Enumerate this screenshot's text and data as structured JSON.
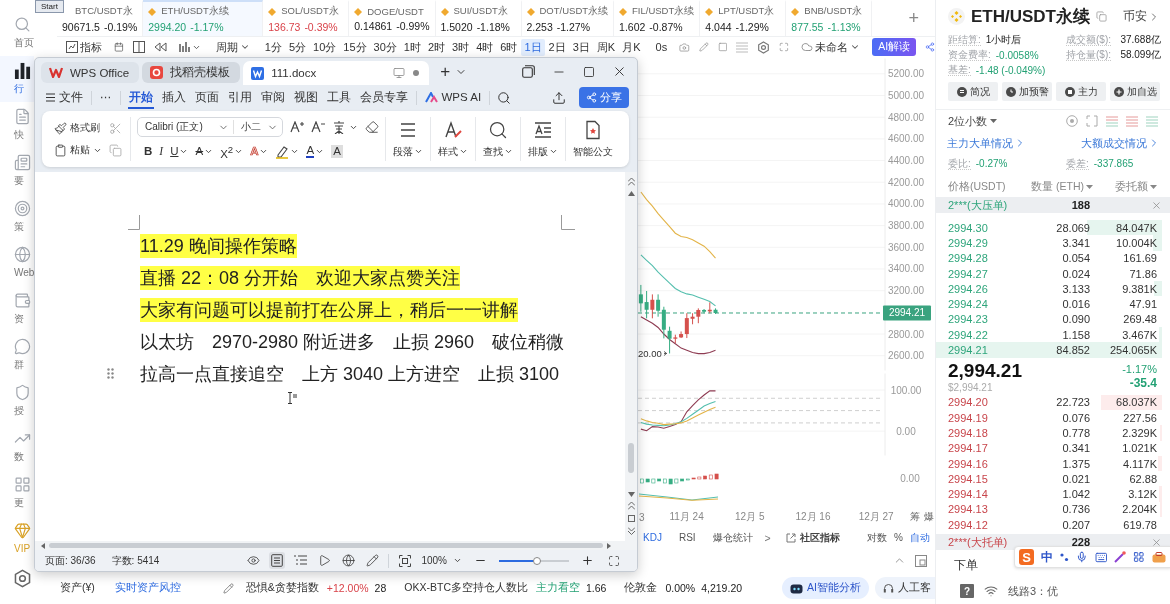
{
  "start_tooltip": "Start",
  "sidebar": {
    "items": [
      {
        "label": "首页",
        "kind": "nav",
        "selected": false
      },
      {
        "label": "行",
        "kind": "nav",
        "selected": true
      },
      {
        "label": "快",
        "kind": "nav",
        "selected": false
      },
      {
        "label": "要",
        "kind": "nav",
        "selected": false
      },
      {
        "label": "策",
        "kind": "nav",
        "selected": false
      },
      {
        "label": "Web",
        "kind": "nav",
        "selected": false
      },
      {
        "label": "资",
        "kind": "nav",
        "selected": false
      },
      {
        "label": "群",
        "kind": "nav",
        "selected": false
      },
      {
        "label": "授",
        "kind": "nav",
        "selected": false
      },
      {
        "label": "数",
        "kind": "nav",
        "selected": false
      },
      {
        "label": "更",
        "kind": "nav",
        "selected": false
      },
      {
        "label": "VIP",
        "kind": "vip",
        "selected": false
      }
    ]
  },
  "tickers": [
    {
      "name": "BTC/USDT永",
      "price": "90671.5",
      "change": "-0.19%",
      "kind": "neutral",
      "marked": false,
      "selected": false
    },
    {
      "name": "ETH/USDT永续",
      "price": "2994.20",
      "change": "-1.17%",
      "kind": "down",
      "marked": true,
      "selected": true
    },
    {
      "name": "SOL/USDT永",
      "price": "136.73",
      "change": "-0.39%",
      "kind": "up",
      "marked": true,
      "selected": false
    },
    {
      "name": "DOGE/USDT",
      "price": "0.14861",
      "change": "-0.99%",
      "kind": "neutral",
      "marked": true,
      "selected": false
    },
    {
      "name": "SUI/USDT永",
      "price": "1.5020",
      "change": "-1.18%",
      "kind": "neutral",
      "marked": true,
      "selected": false
    },
    {
      "name": "DOT/USDT永续",
      "price": "2.253",
      "change": "-1.27%",
      "kind": "neutral",
      "marked": true,
      "selected": false
    },
    {
      "name": "FIL/USDT永续",
      "price": "1.602",
      "change": "-0.87%",
      "kind": "neutral",
      "marked": true,
      "selected": false
    },
    {
      "name": "LPT/USDT永",
      "price": "4.044",
      "change": "-1.29%",
      "kind": "neutral",
      "marked": true,
      "selected": false
    },
    {
      "name": "BNB/USDT永",
      "price": "877.55",
      "change": "-1.13%",
      "kind": "down",
      "marked": true,
      "selected": false
    }
  ],
  "add_tab": "+",
  "toolbar": {
    "indicators": "指标",
    "period": "周期",
    "intervals": [
      {
        "label": "1分",
        "selected": false
      },
      {
        "label": "5分",
        "selected": false
      },
      {
        "label": "10分",
        "selected": false
      },
      {
        "label": "15分",
        "selected": false
      },
      {
        "label": "30分",
        "selected": false
      },
      {
        "label": "1时",
        "selected": false
      },
      {
        "label": "2时",
        "selected": false
      },
      {
        "label": "3时",
        "selected": false
      },
      {
        "label": "4时",
        "selected": false
      },
      {
        "label": "6时",
        "selected": false
      },
      {
        "label": "1日",
        "selected": true
      },
      {
        "label": "2日",
        "selected": false
      },
      {
        "label": "3日",
        "selected": false
      },
      {
        "label": "周K",
        "selected": false
      },
      {
        "label": "月K",
        "selected": false
      }
    ],
    "timer": "0s",
    "layout": "未命名",
    "ai_button": "AI解读"
  },
  "wps": {
    "tabs": [
      {
        "label": "WPS Office",
        "kind": "home",
        "selected": false
      },
      {
        "label": "找稻壳模板",
        "kind": "template",
        "selected": false
      },
      {
        "label": "111.docx",
        "kind": "document",
        "selected": true
      }
    ],
    "new_tab": "+",
    "menu": {
      "file": "文件",
      "more": "⋯",
      "items": [
        {
          "label": "开始",
          "selected": true
        },
        {
          "label": "插入",
          "selected": false
        },
        {
          "label": "页面",
          "selected": false
        },
        {
          "label": "引用",
          "selected": false
        },
        {
          "label": "审阅",
          "selected": false
        },
        {
          "label": "视图",
          "selected": false
        },
        {
          "label": "工具",
          "selected": false
        },
        {
          "label": "会员专享",
          "selected": false
        }
      ],
      "ai": "WPS AI",
      "share": "分享"
    },
    "ribbon": {
      "format_painter": "格式刷",
      "paste": "粘贴",
      "font": "Calibri (正文)",
      "font_size": "小二",
      "format_buttons": [
        {
          "kind": "bold",
          "label": "B",
          "dropdown": false
        },
        {
          "kind": "italic",
          "label": "I",
          "dropdown": false
        },
        {
          "kind": "underline",
          "label": "U",
          "dropdown": true
        },
        {
          "kind": "strike",
          "label": "A",
          "dropdown": true
        },
        {
          "kind": "superscript",
          "label": "X$^{2}$",
          "dropdown": true
        },
        {
          "kind": "outline",
          "label": "A",
          "dropdown": true
        },
        {
          "kind": "highlight",
          "dropdown": true
        },
        {
          "kind": "color",
          "label": "A",
          "dropdown": true
        },
        {
          "kind": "shade",
          "label": "A",
          "dropdown": false
        }
      ],
      "groups": [
        {
          "label": "段落",
          "kind": "paragraph",
          "dropdown": true
        },
        {
          "label": "样式",
          "kind": "styles",
          "dropdown": true
        },
        {
          "label": "查找",
          "kind": "find",
          "dropdown": true
        },
        {
          "label": "排版",
          "kind": "layout",
          "dropdown": true
        },
        {
          "label": "智能公文",
          "kind": "smart",
          "dropdown": false
        }
      ]
    },
    "document": {
      "paragraphs": [
        {
          "text": "11.29 晚间操作策略",
          "highlighted": true,
          "drag_handle": false
        },
        {
          "text": "直播 22：08 分开始　欢迎大家点赞关注",
          "highlighted": true,
          "drag_handle": false
        },
        {
          "text": "大家有问题可以提前打在公屏上，稍后一一讲解",
          "highlighted": true,
          "drag_handle": false
        },
        {
          "text": "以太坊　2970-2980 附近进多　止损 2960　破位稍微",
          "highlighted": false,
          "drag_handle": false
        },
        {
          "text": "拉高一点直接追空　上方 3040 上方进空　止损 3100",
          "highlighted": false,
          "drag_handle": true
        }
      ]
    },
    "status": {
      "pages": "页面: 36/36",
      "words": "字数: 5414",
      "view_modes": [
        {
          "selected": false
        },
        {
          "selected": true
        },
        {
          "selected": false
        },
        {
          "selected": false
        },
        {
          "selected": false
        },
        {
          "selected": false
        }
      ],
      "zoom": "100%",
      "zoom_slider": {
        "level": 0.54
      }
    }
  },
  "chart": {
    "chart_data": [
      {
        "type": "candlestick",
        "categories": [
          null,
          null,
          null,
          null,
          null,
          null,
          null,
          null,
          null,
          null,
          null,
          null,
          null,
          null,
          null,
          null,
          null,
          null,
          null,
          null,
          null,
          null,
          null,
          null,
          null,
          null,
          null,
          null,
          null,
          null,
          null,
          null,
          null,
          null,
          null,
          null,
          null,
          null,
          null,
          null,
          null,
          null,
          null
        ],
        "ohlc": [
          [
            3166,
            3253,
            3006,
            3083
          ],
          [
            3095,
            3197,
            2945,
            3024
          ],
          [
            3024,
            3166,
            2945,
            3116
          ],
          [
            3116,
            3166,
            2960,
            3015
          ],
          [
            3024,
            3052,
            2760,
            2840
          ],
          [
            2830,
            2868,
            2621,
            2757
          ],
          [
            2757,
            2794,
            2717,
            2769
          ],
          [
            2769,
            2824,
            2763,
            2800
          ],
          [
            2800,
            2992,
            2763,
            2947
          ],
          [
            2941,
            2992,
            2890,
            2960
          ],
          [
            2960,
            3037,
            2900,
            3022
          ],
          [
            3022,
            3031,
            2991,
            3006
          ],
          [
            3009,
            3092,
            2991,
            3024
          ],
          [
            3024,
            3037,
            2985,
            2994.21
          ],
          null,
          null,
          null,
          null,
          null,
          null,
          null,
          null,
          null,
          null,
          null,
          null,
          null,
          null,
          null,
          null,
          null,
          null,
          null,
          null,
          null,
          null,
          null,
          null,
          null,
          null,
          null,
          null,
          null
        ],
        "series": [
          {
            "type": "line",
            "color": "#e3b448",
            "values": [
              4110,
              4040,
              3980,
              3910,
              3850,
              3790,
              3730,
              3700,
              3690,
              3670,
              3640,
              3610,
              3560,
              3500,
              null,
              null,
              null,
              null,
              null,
              null,
              null,
              null,
              null,
              null,
              null,
              null,
              null,
              null,
              null,
              null,
              null,
              null,
              null,
              null,
              null,
              null,
              null,
              null,
              null,
              null,
              null,
              null,
              null
            ]
          },
          {
            "type": "line",
            "color": "#55bfae",
            "values": [
              3530,
              3480,
              3430,
              3370,
              3320,
              3270,
              3220,
              3190,
              3170,
              3160,
              3140,
              3120,
              3100,
              3060,
              null,
              null,
              null,
              null,
              null,
              null,
              null,
              null,
              null,
              null,
              null,
              null,
              null,
              null,
              null,
              null,
              null,
              null,
              null,
              null,
              null,
              null,
              null,
              null,
              null,
              null,
              null,
              null,
              null
            ]
          },
          {
            "type": "line",
            "color": "#8e3b52",
            "values": [
              2960,
              2930,
              2900,
              2860,
              2800,
              2750,
              2710,
              2670,
              2650,
              2630,
              2620,
              2620,
              2630,
              2650,
              null,
              null,
              null,
              null,
              null,
              null,
              null,
              null,
              null,
              null,
              null,
              null,
              null,
              null,
              null,
              null,
              null,
              null,
              null,
              null,
              null,
              null,
              null,
              null,
              null,
              null,
              null,
              null,
              null
            ]
          }
        ],
        "ylim": [
          2450,
          5355
        ],
        "yticks": [
          {
            "value": 2600,
            "label": "2600.00"
          },
          {
            "value": 2800,
            "label": "2800.00"
          },
          {
            "value": 3200,
            "label": "3200.00"
          },
          {
            "value": 3400,
            "label": "3400.00"
          },
          {
            "value": 3600,
            "label": "3600.00"
          },
          {
            "value": 3800,
            "label": "3800.00"
          },
          {
            "value": 4000,
            "label": "4000.00"
          },
          {
            "value": 4200,
            "label": "4200.00"
          },
          {
            "value": 4400,
            "label": "4400.00"
          },
          {
            "value": 4600,
            "label": "4600.00"
          },
          {
            "value": 4800,
            "label": "4800.00"
          },
          {
            "value": 5000,
            "label": "5000.00"
          },
          {
            "value": 5200,
            "label": "5200.00"
          }
        ],
        "tick_labels": "y",
        "ref_lines": [
          {
            "axis": "y",
            "value": 2994.21,
            "label": "2994.21",
            "color": "#3aa37f",
            "line_style": "dashed"
          }
        ],
        "annotations": [
          "20.00"
        ],
        "grid": true
      },
      {
        "type": "line",
        "categories": [
          null,
          null,
          null,
          null,
          null,
          null,
          null,
          null,
          null,
          null,
          null,
          null,
          null,
          null,
          null,
          null,
          null,
          null,
          null,
          null,
          null,
          null,
          null,
          null,
          null,
          null,
          null,
          null,
          null,
          null,
          null,
          null,
          null,
          null,
          null,
          null,
          null,
          null,
          null,
          null,
          null,
          null,
          null
        ],
        "series": [
          {
            "color": "#8e3b52",
            "values": [
              5,
              1,
              11,
              10,
              7,
              11,
              16,
              23,
              47,
              62,
              76,
              88,
              98,
              98,
              null,
              null,
              null,
              null,
              null,
              null,
              null,
              null,
              null,
              null,
              null,
              null,
              null,
              null,
              null,
              null,
              null,
              null,
              null,
              null,
              null,
              null,
              null,
              null,
              null,
              null,
              null,
              null,
              null
            ]
          },
          {
            "color": "#55bfae",
            "values": [
              21,
              17,
              15,
              14,
              13,
              15,
              18,
              23,
              31,
              41,
              51,
              61,
              67,
              72,
              null,
              null,
              null,
              null,
              null,
              null,
              null,
              null,
              null,
              null,
              null,
              null,
              null,
              null,
              null,
              null,
              null,
              null,
              null,
              null,
              null,
              null,
              null,
              null,
              null,
              null,
              null,
              null,
              null
            ]
          },
          {
            "color": "#e3b448",
            "values": [
              30,
              25,
              21,
              19,
              16,
              17,
              18,
              20,
              25,
              32,
              39,
              46,
              53,
              58,
              null,
              null,
              null,
              null,
              null,
              null,
              null,
              null,
              null,
              null,
              null,
              null,
              null,
              null,
              null,
              null,
              null,
              null,
              null,
              null,
              null,
              null,
              null,
              null,
              null,
              null,
              null,
              null,
              null
            ]
          }
        ],
        "ylim": [
          -63,
          144
        ],
        "yticks": [
          {
            "value": 0,
            "label": "0.00"
          },
          {
            "value": 100,
            "label": "100.00"
          }
        ],
        "tick_labels": "y",
        "ref_lines": [
          {
            "axis": "y",
            "value": 80,
            "color": "#cfcfcf",
            "line_style": "dashed"
          },
          {
            "axis": "y",
            "value": 50,
            "color": "#cfcfcf",
            "line_style": "dashed"
          },
          {
            "axis": "y",
            "value": 20,
            "color": "#cfcfcf",
            "line_style": "dashed"
          }
        ],
        "grid": true
      }
    ],
    "macd_axis_label": "0.00",
    "x_axis": {
      "fragment": "3",
      "labels": [
        "11月 24",
        "12月 5",
        "12月 16",
        "12月 27"
      ],
      "buttons": [
        "筹",
        "爆"
      ]
    },
    "indicator_tabs": [
      {
        "label": "KDJ",
        "selected": true
      },
      {
        "label": "RSI",
        "selected": false
      },
      {
        "label": "爆仓统计",
        "selected": false
      }
    ],
    "more": ">",
    "community": "社区指标",
    "scale_options": [
      {
        "label": "对数",
        "selected": false
      },
      {
        "label": "%",
        "selected": false
      },
      {
        "label": "自动",
        "selected": true
      }
    ]
  },
  "bottom_bar": {
    "asset_label": "资产(¥)",
    "risk_link": "实时资产风控",
    "indicators": [
      {
        "name": "恐惧&贪婪指数",
        "values": [
          {
            "text": "+12.00%",
            "kind": "up"
          },
          {
            "text": "28",
            "kind": "neutral"
          }
        ]
      },
      {
        "name": "OKX-BTC多空持仓人数比",
        "values": [
          {
            "text": "主力看空",
            "kind": "down"
          },
          {
            "text": "1.66",
            "kind": "neutral"
          }
        ]
      },
      {
        "name": "伦敦金",
        "values": [
          {
            "text": "0.00%",
            "kind": "neutral"
          },
          {
            "text": "4,219.20",
            "kind": "neutral"
          }
        ]
      }
    ],
    "ai_button": "AI智能分析",
    "service_button": "人工客"
  },
  "right_panel": {
    "symbol": "ETH/USDT永续",
    "exchange": "币安",
    "stats": [
      {
        "label": "距结算:",
        "value": "1小时后",
        "kind": "neutral"
      },
      {
        "label": "成交额($):",
        "value": "37.688亿",
        "kind": "neutral"
      },
      {
        "label": "资金费率:",
        "value": "-0.0058%",
        "kind": "down"
      },
      {
        "label": "持仓量($):",
        "value": "58.099亿",
        "kind": "neutral"
      },
      {
        "label": "基差:",
        "value": "-1.48 (-0.049%)",
        "kind": "down"
      }
    ],
    "actions": [
      "简况",
      "加预警",
      "主力",
      "加自选"
    ],
    "decimals": "2位小数",
    "links": [
      "主力大单情况",
      "大额成交情况"
    ],
    "ratios": [
      {
        "label": "委比:",
        "value": "-0.27%",
        "kind": "down"
      },
      {
        "label": "委差:",
        "value": "-337.865",
        "kind": "down"
      }
    ],
    "columns": [
      "价格(USDT)",
      "数量 (ETH)",
      "委托额"
    ],
    "pinned_ask": {
      "label": "2***(大压单)",
      "amount": "188"
    },
    "asks": [
      {
        "price": "2994.30",
        "qty": "28.069",
        "total": "84.047K"
      },
      {
        "price": "2994.29",
        "qty": "3.341",
        "total": "10.004K"
      },
      {
        "price": "2994.28",
        "qty": "0.054",
        "total": "161.69"
      },
      {
        "price": "2994.27",
        "qty": "0.024",
        "total": "71.86"
      },
      {
        "price": "2994.26",
        "qty": "3.133",
        "total": "9.381K"
      },
      {
        "price": "2994.24",
        "qty": "0.016",
        "total": "47.91"
      },
      {
        "price": "2994.23",
        "qty": "0.090",
        "total": "269.48"
      },
      {
        "price": "2994.22",
        "qty": "1.158",
        "total": "3.467K"
      },
      {
        "price": "2994.21",
        "qty": "84.852",
        "total": "254.065K"
      }
    ],
    "last": {
      "price": "2,994.21",
      "usd": "$2,994.21",
      "change_pct": "-1.17%",
      "change": "-35.4",
      "kind": "down"
    },
    "bids": [
      {
        "price": "2994.20",
        "qty": "22.723",
        "total": "68.037K"
      },
      {
        "price": "2994.19",
        "qty": "0.076",
        "total": "227.56"
      },
      {
        "price": "2994.18",
        "qty": "0.778",
        "total": "2.329K"
      },
      {
        "price": "2994.17",
        "qty": "0.341",
        "total": "1.021K"
      },
      {
        "price": "2994.16",
        "qty": "1.375",
        "total": "4.117K"
      },
      {
        "price": "2994.15",
        "qty": "0.021",
        "total": "62.88"
      },
      {
        "price": "2994.14",
        "qty": "1.042",
        "total": "3.12K"
      },
      {
        "price": "2994.13",
        "qty": "0.736",
        "total": "2.204K"
      },
      {
        "price": "2994.12",
        "qty": "0.207",
        "total": "619.78"
      }
    ],
    "pinned_bid": {
      "label": "2***(大托单)",
      "amount": "228"
    },
    "bottom_tabs": [
      "下单"
    ],
    "help": "?",
    "line_status": "线路3：优"
  },
  "ime_toolbar": {
    "logo": "S",
    "mode": "中"
  }
}
